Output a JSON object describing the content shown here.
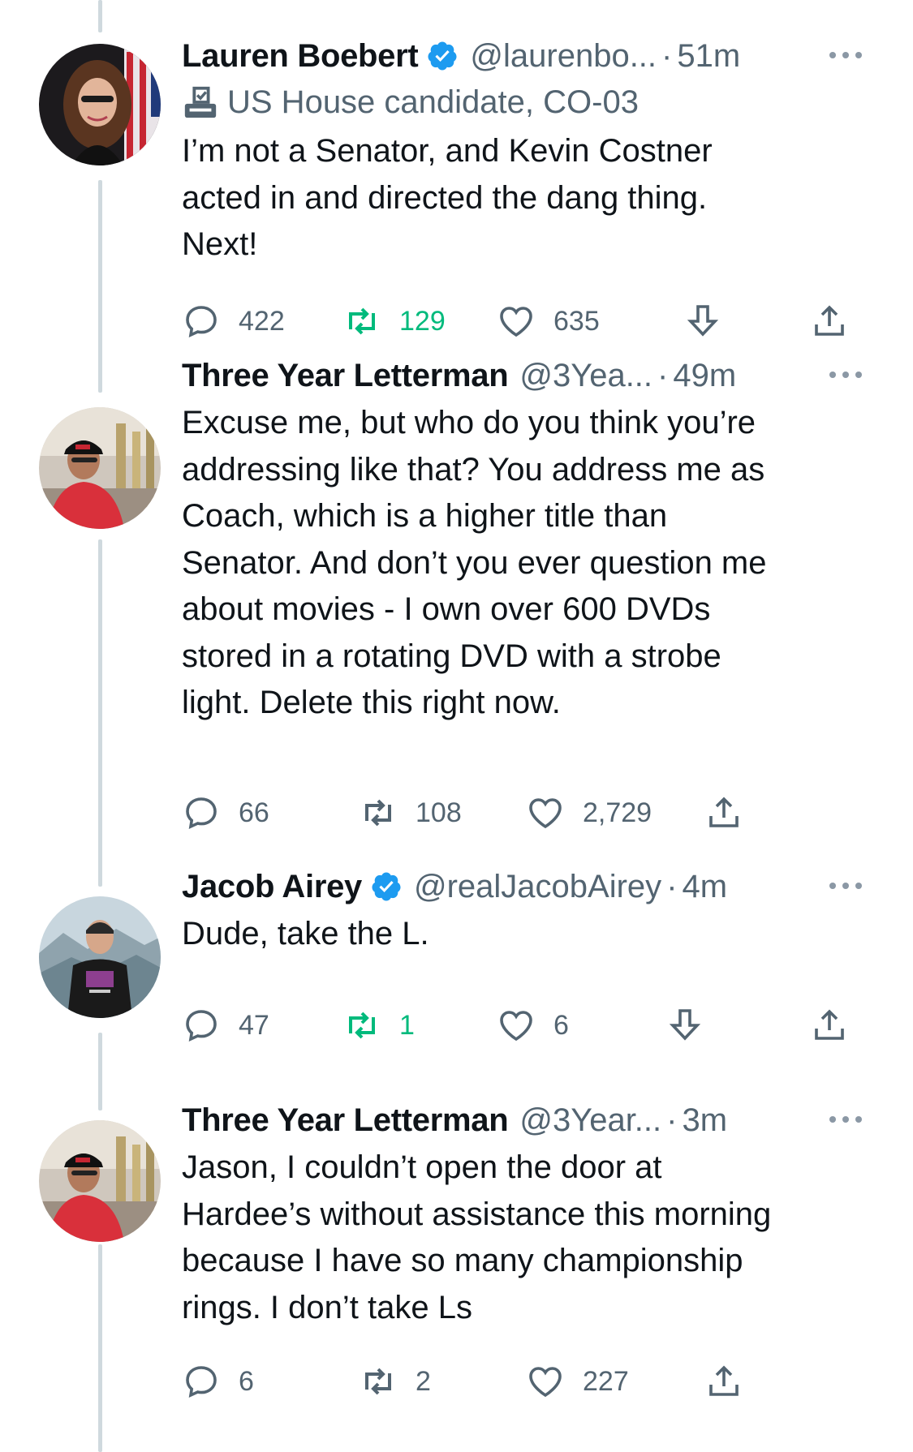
{
  "colors": {
    "text": "#0f1419",
    "secondary": "#536471",
    "verified": "#1d9bf0",
    "retweet_active": "#00ba7c",
    "thread_line": "#cfd9de"
  },
  "tweets": [
    {
      "name": "Lauren Boebert",
      "verified": true,
      "handle": "@laurenbo...",
      "time": "51m",
      "label": "US House candidate, CO-03",
      "label_icon": "ballot-box-icon",
      "text": "I’m not a Senator, and Kevin Costner\nacted in and directed the dang thing.\nNext!",
      "replies": "422",
      "retweets": "129",
      "likes": "635",
      "retweet_active": true,
      "has_download": true
    },
    {
      "name": "Three Year Letterman",
      "verified": false,
      "handle": "@3Yea...",
      "time": "49m",
      "text": "Excuse me, but who do you think you’re\naddressing like that? You address me as\nCoach, which is a higher title than\nSenator. And don’t you ever question me\nabout movies - I own over 600 DVDs\nstored in a rotating DVD with a strobe\nlight. Delete this right now.",
      "replies": "66",
      "retweets": "108",
      "likes": "2,729",
      "retweet_active": false,
      "has_download": false
    },
    {
      "name": "Jacob Airey",
      "verified": true,
      "handle": "@realJacobAirey",
      "time": "4m",
      "text": "Dude, take the L.",
      "replies": "47",
      "retweets": "1",
      "likes": "6",
      "retweet_active": true,
      "has_download": true
    },
    {
      "name": "Three Year Letterman",
      "verified": false,
      "handle": "@3Year...",
      "time": "3m",
      "text": "Jason, I couldn’t open the door at\nHardee’s without assistance this morning\nbecause I have so many championship\nrings. I don’t take Ls",
      "replies": "6",
      "retweets": "2",
      "likes": "227",
      "retweet_active": false,
      "has_download": false
    }
  ],
  "separator": "·"
}
